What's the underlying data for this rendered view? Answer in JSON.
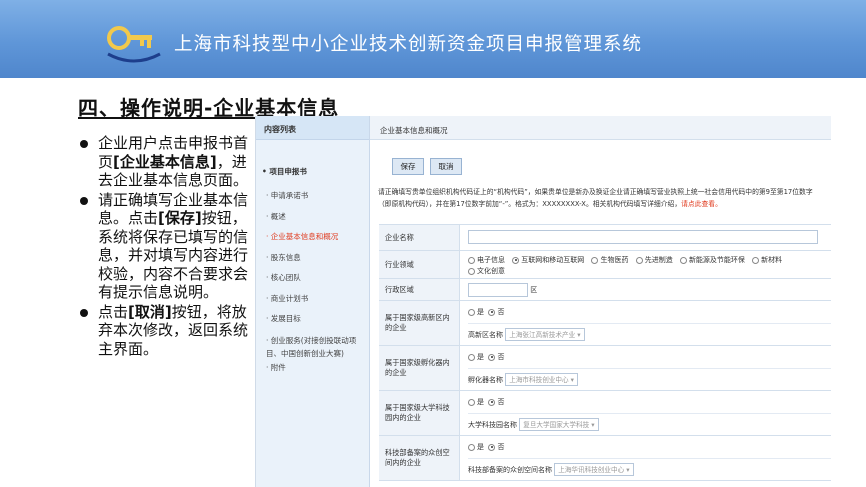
{
  "header": {
    "title": "上海市科技型中小企业技术创新资金项目申报管理系统"
  },
  "slide": {
    "heading": "四、操作说明-企业基本信息",
    "bullets": [
      {
        "pre": "企业用户点击申报书首页",
        "bold": "[企业基本信息]",
        "post": "，进去企业基本信息页面。"
      },
      {
        "pre": "请正确填写企业基本信息。点击",
        "bold": "[保存]",
        "post": "按钮，系统将保存已填写的信息，并对填写内容进行校验，内容不合要求会有提示信息说明。"
      },
      {
        "pre": "点击",
        "bold": "[取消]",
        "post": "按钮，将放弃本次修改，返回系统主界面。"
      }
    ]
  },
  "app": {
    "sidebar": {
      "header": "内容列表",
      "group": "• 项目申报书",
      "items": [
        "· 申请承诺书",
        "· 概述",
        "· 企业基本信息和概况",
        "· 股东信息",
        "· 核心团队",
        "· 商业计划书",
        "· 发展目标",
        "· 创业服务(对接创投联动项目、中国创新创业大赛)",
        "· 附件"
      ]
    },
    "main": {
      "header": "企业基本信息和概况",
      "save_label": "保存",
      "cancel_label": "取消",
      "notice_pre": "请正确填写贵单位组织机构代码证上的“机构代码”，如果贵单位是新办及换证企业请正确填写营业执照上统一社会信用代码中的第9至第17位数字（即原机构代码），并在第17位数字前加“-”。格式为：XXXXXXXX-X。相关机构代码填写详细介绍，",
      "notice_link": "请点此查看。",
      "rows": {
        "company_name_label": "企业名称",
        "industry_label": "行业领域",
        "industry_options": [
          "电子信息",
          "互联网和移动互联网",
          "生物医药",
          "先进制造",
          "新能源及节能环保",
          "新材料",
          "文化创意"
        ],
        "region_label": "行政区域",
        "region_suffix": "区",
        "hightech_label": "属于国家级高新区内的企业",
        "hightech_sub_label": "高新区名称",
        "hightech_select": "上海张江高新技术产业",
        "incubator_label": "属于国家级孵化器内的企业",
        "incubator_sub_label": "孵化器名称",
        "incubator_select": "上海市科技创业中心",
        "univ_label": "属于国家级大学科技园内的企业",
        "univ_sub_label": "大学科技园名称",
        "univ_select": "复旦大学国家大学科技",
        "maker_label": "科技部备案的众创空间内的企业",
        "maker_sub_label": "科技部备案的众创空间名称",
        "maker_select": "上海华讯科技创业中心",
        "yes": "是",
        "no": "否"
      }
    }
  }
}
